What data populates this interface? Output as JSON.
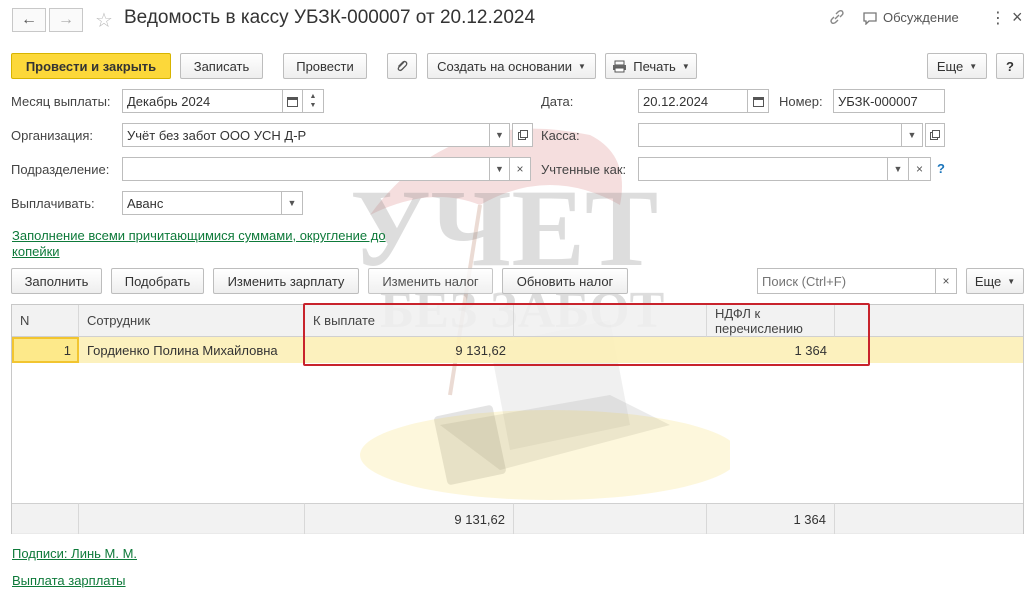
{
  "header": {
    "back_icon": "arrow-left-icon",
    "forward_icon": "arrow-right-icon",
    "title": "Ведомость в кассу УБЗК-000007 от 20.12.2024",
    "discussion": "Обсуждение"
  },
  "toolbar": {
    "post_close": "Провести и закрыть",
    "save": "Записать",
    "post": "Провести",
    "create_based": "Создать на основании",
    "print": "Печать",
    "more": "Еще"
  },
  "form": {
    "month_label": "Месяц выплаты:",
    "month_value": "Декабрь 2024",
    "date_label": "Дата:",
    "date_value": "20.12.2024",
    "number_label": "Номер:",
    "number_value": "УБЗК-000007",
    "org_label": "Организация:",
    "org_value": "Учёт без забот ООО УСН Д-Р",
    "cash_label": "Касса:",
    "cash_value": "",
    "dept_label": "Подразделение:",
    "dept_value": "",
    "counted_label": "Учтенные как:",
    "counted_value": "",
    "help": "?",
    "pay_label": "Выплачивать:",
    "pay_value": "Аванс",
    "fill_link": "Заполнение всеми причитающимися суммами, округление до копейки"
  },
  "table_toolbar": {
    "fill": "Заполнить",
    "pick": "Подобрать",
    "change_salary": "Изменить зарплату",
    "change_tax": "Изменить налог",
    "update_tax": "Обновить налог",
    "search_placeholder": "Поиск (Ctrl+F)",
    "clear": "×",
    "more": "Еще"
  },
  "table": {
    "columns": [
      "N",
      "Сотрудник",
      "К выплате",
      "",
      "НДФЛ к перечислению"
    ],
    "rows": [
      {
        "n": "1",
        "employee": "Гордиенко Полина Михайловна",
        "pay": "9 131,62",
        "ndfl": "1 364"
      }
    ],
    "totals": {
      "pay": "9 131,62",
      "ndfl": "1 364"
    }
  },
  "footer": {
    "signatures": "Подписи: Линь М. М.",
    "payout": "Выплата зарплаты"
  },
  "watermark": {
    "line1": "УЧЕТ",
    "line2": "БЕЗ ЗАБОТ"
  },
  "colors": {
    "primary": "#fcd83a",
    "link": "#0e7a3a",
    "highlight": "#c8232c",
    "row_selected": "#fcf0b8"
  }
}
